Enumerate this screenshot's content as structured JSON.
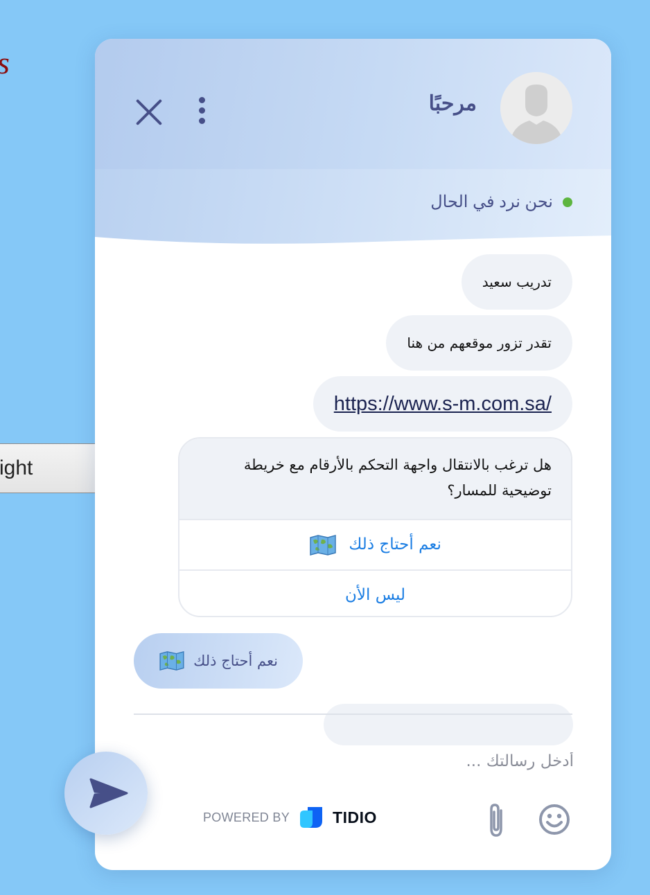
{
  "background_page": {
    "letter": "s",
    "button_label": "ight"
  },
  "header": {
    "title": "مرحبًا",
    "status_text": "نحن نرد في الحال",
    "status_color": "#5db53f",
    "close_icon": "close-icon",
    "menu_icon": "more-vertical-icon"
  },
  "messages": [
    {
      "text": "تدريب سعيد"
    },
    {
      "text": "تقدر تزور موقعهم من هنا"
    },
    {
      "text": "https://www.s-m.com.sa/"
    }
  ],
  "card": {
    "question": "هل ترغب بالانتقال واجهة التحكم بالأرقام مع خريطة توضيحية للمسار؟",
    "options": [
      "نعم أحتاج ذلك",
      "ليس الأن"
    ],
    "option_icon": "world-map-icon"
  },
  "user_reply": {
    "text": "نعم أحتاج ذلك"
  },
  "composer": {
    "placeholder": "أدخل رسالتك ...",
    "powered_by": "POWERED BY",
    "brand": "TIDIO"
  },
  "colors": {
    "accent": "#464f88",
    "link": "#1a7de3",
    "page_background": "#85c8f7"
  }
}
